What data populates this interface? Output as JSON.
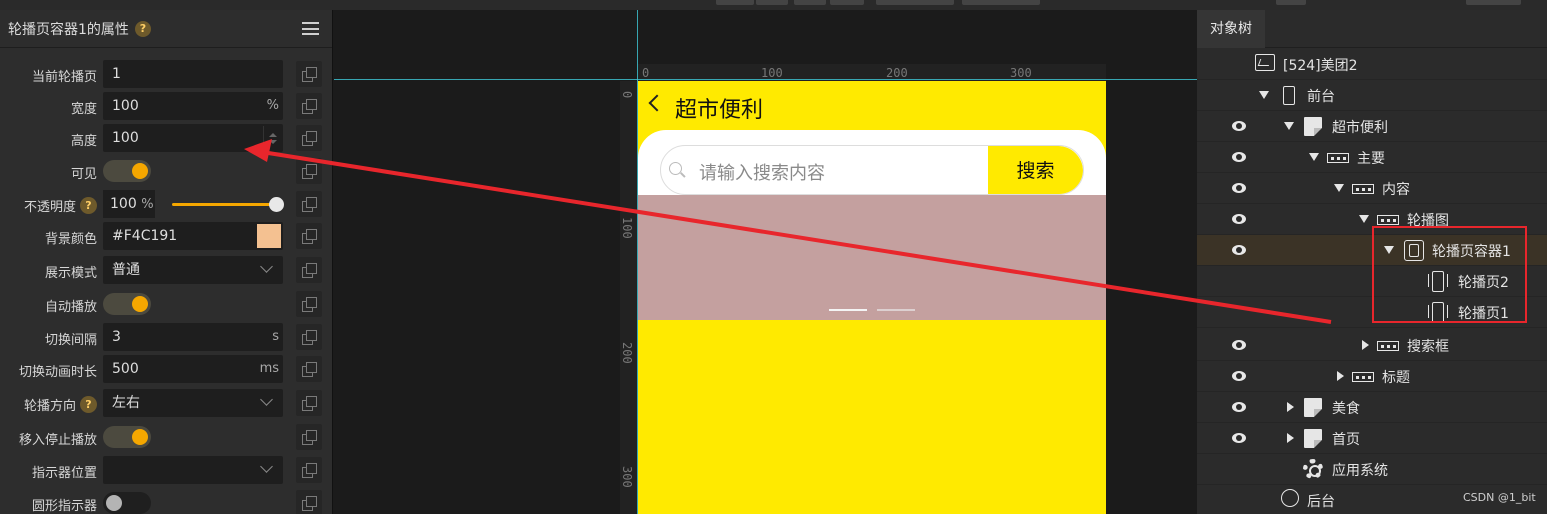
{
  "colors": {
    "accent": "#F5A700",
    "bg_color_swatch": "#F4C191",
    "phone_bg": "#FFEA00",
    "carousel_bg": "#C4A09F",
    "annotation_red": "#E8262C",
    "guide": "#3EC9D8"
  },
  "properties_panel": {
    "title": "轮播页容器1的属性",
    "help": "?",
    "rows": [
      {
        "label": "当前轮播页",
        "value": "1"
      },
      {
        "label": "宽度",
        "value": "100",
        "unit": "%"
      },
      {
        "label": "高度",
        "value": "100"
      },
      {
        "label": "可见",
        "toggle": true
      },
      {
        "label": "不透明度",
        "value": "100",
        "unit": "%",
        "slider_percent": 100
      },
      {
        "label": "背景颜色",
        "value": "#F4C191"
      },
      {
        "label": "展示模式",
        "value": "普通"
      },
      {
        "label": "自动播放",
        "toggle": true
      },
      {
        "label": "切换间隔",
        "value": "3",
        "unit": "s"
      },
      {
        "label": "切换动画时长",
        "value": "500",
        "unit": "ms"
      },
      {
        "label": "轮播方向",
        "value": "左右"
      },
      {
        "label": "移入停止播放",
        "toggle": true
      },
      {
        "label": "指示器位置",
        "value": ""
      },
      {
        "label": "圆形指示器",
        "toggle": false
      }
    ]
  },
  "canvas": {
    "ruler_top": [
      "0",
      "100",
      "200",
      "300"
    ],
    "ruler_left": [
      "0",
      "100",
      "200",
      "300"
    ],
    "phone": {
      "title": "超市便利",
      "search_placeholder": "请输入搜索内容",
      "search_button": "搜索"
    }
  },
  "tree_panel": {
    "tab": "对象树",
    "items": [
      {
        "label": "[524]美团2",
        "icon": "site-icon"
      },
      {
        "label": "前台",
        "icon": "phone-icon"
      },
      {
        "label": "超市便利",
        "icon": "page-icon"
      },
      {
        "label": "主要",
        "icon": "container-icon"
      },
      {
        "label": "内容",
        "icon": "container-icon"
      },
      {
        "label": "轮播图",
        "icon": "container-icon"
      },
      {
        "label": "轮播页容器1",
        "icon": "carousel-icon"
      },
      {
        "label": "轮播页2",
        "icon": "slide-icon"
      },
      {
        "label": "轮播页1",
        "icon": "slide-icon"
      },
      {
        "label": "搜索框",
        "icon": "container-icon"
      },
      {
        "label": "标题",
        "icon": "container-icon"
      },
      {
        "label": "美食",
        "icon": "page-icon"
      },
      {
        "label": "首页",
        "icon": "page-icon"
      },
      {
        "label": "应用系统",
        "icon": "gear-icon"
      },
      {
        "label": "后台",
        "icon": "backend-icon"
      }
    ]
  },
  "watermark": "CSDN @1_bit"
}
